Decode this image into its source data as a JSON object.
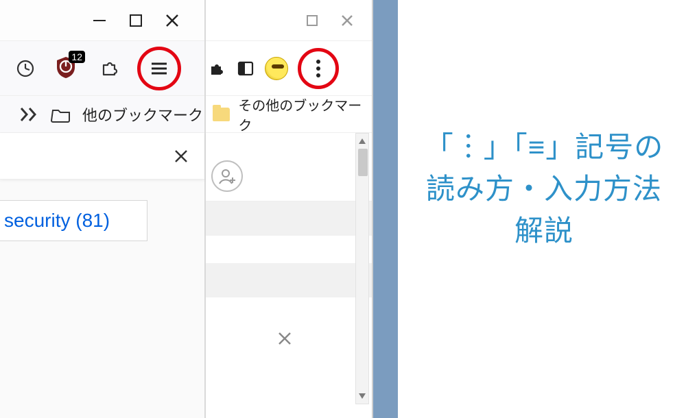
{
  "left_window": {
    "extension_badge_count": "12",
    "other_bookmarks_label": "他のブックマーク",
    "tag_label": "security (81)"
  },
  "right_window": {
    "other_bookmarks_label": "その他のブックマーク"
  },
  "title": {
    "line1": "「︙」「≡」記号の",
    "line2": "読み方・入力方法",
    "line3": "解説"
  },
  "icons": {
    "minimize": "minimize-icon",
    "maximize": "maximize-icon",
    "close": "close-icon",
    "clock": "clock-icon",
    "shield": "shield-icon",
    "puzzle": "puzzle-icon",
    "hamburger": "hamburger-menu-icon",
    "chevrons": "chevrons-right-icon",
    "folder_outline": "folder-outline-icon",
    "extension": "extension-icon",
    "panel": "side-panel-icon",
    "avatar": "profile-avatar-icon",
    "kebab": "kebab-menu-icon",
    "folder_fill": "folder-icon",
    "add_person": "add-person-icon",
    "scroll_up": "scroll-up-arrow-icon",
    "scroll_down": "scroll-down-arrow-icon"
  }
}
